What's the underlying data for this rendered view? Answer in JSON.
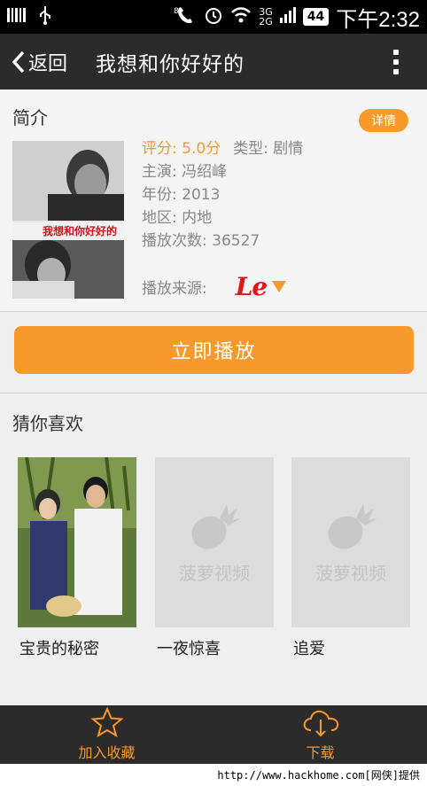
{
  "status_bar": {
    "time": "下午2:32",
    "battery": "44",
    "network": "3G",
    "network2": "2G"
  },
  "app_bar": {
    "back_label": "返回",
    "title": "我想和你好好的"
  },
  "intro": {
    "heading": "简介",
    "detail_button": "详情",
    "rating": "评分: 5.0分",
    "type": "类型: 剧情",
    "cast": "主演: 冯绍峰",
    "year": "年份: 2013",
    "region": "地区: 内地",
    "play_count": "播放次数: 36527",
    "source_label": "播放来源:",
    "source_logo": "Le"
  },
  "play_button": "立即播放",
  "recommendations": {
    "heading": "猜你喜欢",
    "items": [
      {
        "title": "宝贵的秘密",
        "placeholder": ""
      },
      {
        "title": "一夜惊喜",
        "placeholder": "菠萝视频"
      },
      {
        "title": "追爱",
        "placeholder": "菠萝视频"
      }
    ]
  },
  "bottom_bar": {
    "favorite_label": "加入收藏",
    "download_label": "下载"
  },
  "footer": "http://www.hackhome.com[网侠]提供",
  "colors": {
    "accent": "#f8992a",
    "dark_bar": "#2b2b2b",
    "le_red": "#e2151b"
  }
}
